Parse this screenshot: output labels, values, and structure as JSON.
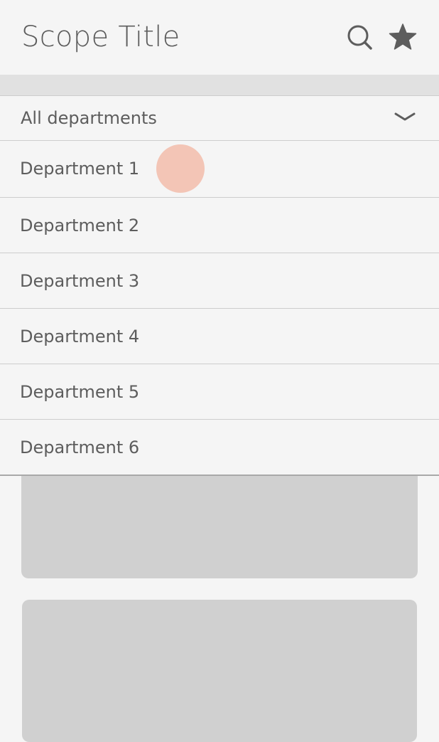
{
  "header": {
    "title": "Scope Title",
    "icons": [
      "search-icon",
      "star-icon"
    ]
  },
  "filter": {
    "selected_label": "All departments",
    "icon": "chevron-down-icon"
  },
  "departments": [
    {
      "label": "Department 1"
    },
    {
      "label": "Department 2"
    },
    {
      "label": "Department 3"
    },
    {
      "label": "Department 4"
    },
    {
      "label": "Department 5"
    },
    {
      "label": "Department 6"
    }
  ],
  "touch_indicator_color": "#f3c5b6",
  "colors": {
    "background": "#f5f5f5",
    "text": "#5d5d5d",
    "separator_band": "#e1e1e1",
    "divider": "#cdcdcd",
    "card_placeholder": "#d0d0d0"
  }
}
